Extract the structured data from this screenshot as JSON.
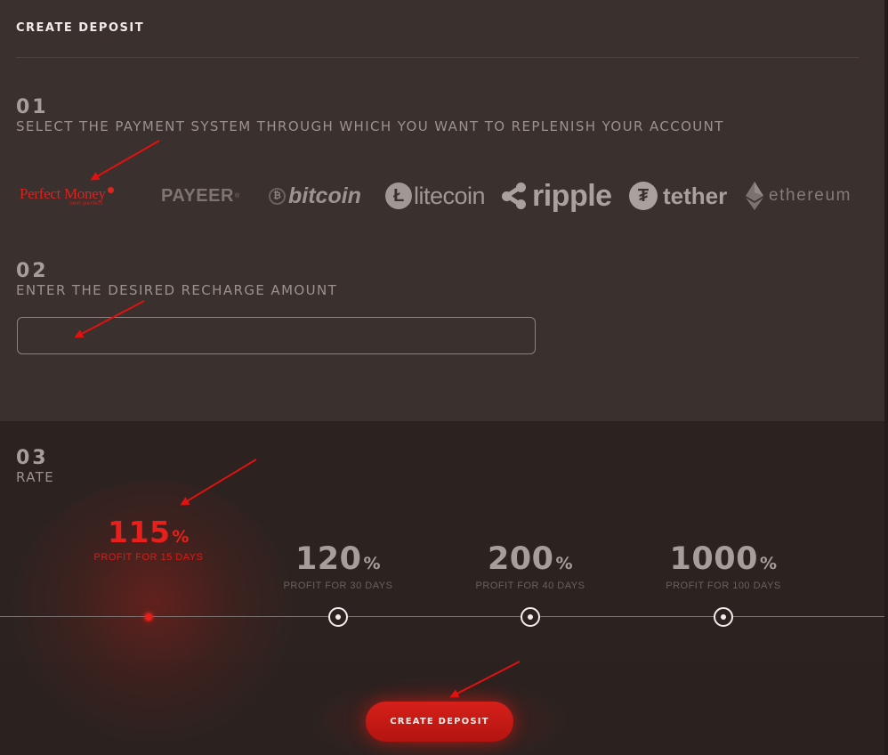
{
  "panel_title": "CREATE DEPOSIT",
  "step1": {
    "number": "01",
    "label": "SELECT THE PAYMENT SYSTEM THROUGH WHICH YOU WANT TO REPLENISH YOUR ACCOUNT",
    "payment_systems": {
      "perfect_money": "Perfect Money",
      "perfect_money_tagline": "next-perfect",
      "payeer": "PAYEER",
      "bitcoin": "bitcoin",
      "bitcoin_symbol": "₿",
      "litecoin": "litecoin",
      "litecoin_symbol": "Ł",
      "ripple": "ripple",
      "tether": "tether",
      "tether_symbol": "₮",
      "ethereum": "ethereum"
    },
    "selected": "Perfect Money"
  },
  "step2": {
    "number": "02",
    "label": "ENTER THE DESIRED RECHARGE AMOUNT",
    "amount_value": ""
  },
  "step3": {
    "number": "03",
    "label": "RATE",
    "plans": [
      {
        "percent": "115",
        "sign": "%",
        "desc": "PROFIT FOR 15 DAYS",
        "active": true
      },
      {
        "percent": "120",
        "sign": "%",
        "desc": "PROFIT FOR 30 DAYS",
        "active": false
      },
      {
        "percent": "200",
        "sign": "%",
        "desc": "PROFIT FOR 40 DAYS",
        "active": false
      },
      {
        "percent": "1000",
        "sign": "%",
        "desc": "PROFIT FOR 100 DAYS",
        "active": false
      }
    ]
  },
  "submit_label": "CREATE DEPOSIT",
  "colors": {
    "accent": "#e8201b",
    "panel_top": "#3a302e",
    "panel_rate": "#2c2321",
    "annotation_arrow": "#e0120f"
  }
}
